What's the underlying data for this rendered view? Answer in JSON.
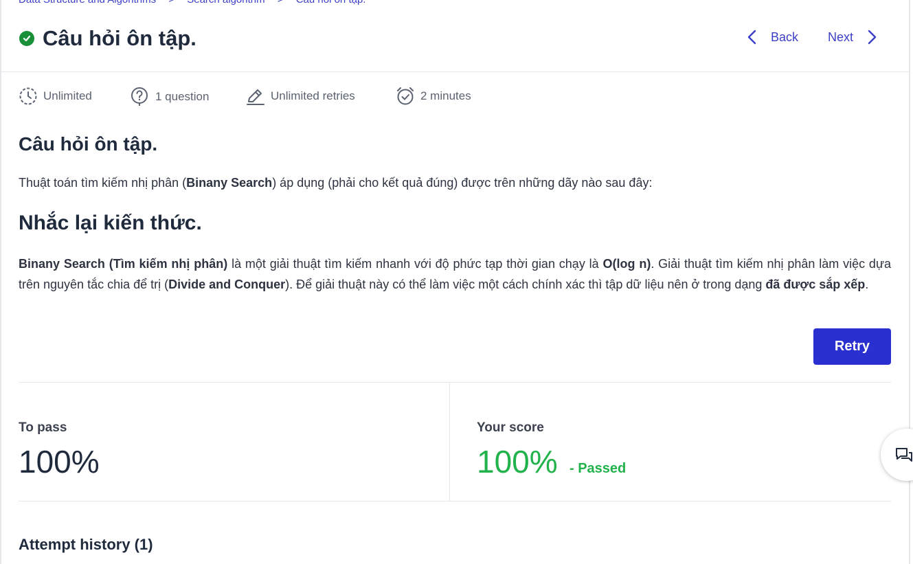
{
  "breadcrumb": [
    "Data Structure and Algorithms",
    ">",
    "Search algorithm",
    ">",
    "Câu hỏi ôn tập."
  ],
  "header": {
    "title": "Câu hỏi ôn tập.",
    "back_label": "Back",
    "next_label": "Next"
  },
  "meta": {
    "time": "Unlimited",
    "questions": "1 question",
    "retries": "Unlimited retries",
    "duration": "2 minutes"
  },
  "content": {
    "section_title": "Câu hỏi ôn tập.",
    "question_pre": "Thuật toán tìm kiếm nhị phân (",
    "question_bold": "Binany Search",
    "question_post": ") áp dụng (phải cho kết quả đúng) được trên những dãy nào sau đây:",
    "remind_title": "Nhắc lại kiến thức.",
    "p1_bold": "Binany Search (Tìm kiếm nhị phân)",
    "p1_a": " là một giải thuật tìm kiếm nhanh với độ phức tạp thời gian chạy là ",
    "p1_bold2": "O(log n)",
    "p1_b": ". Giải thuật tìm kiếm nhị phân làm việc dựa trên nguyên tắc chia để trị (",
    "p1_bold3": "Divide and Conquer",
    "p1_c": "). Để giải thuật này có thể làm việc một cách chính xác thì tập dữ liệu nên ở trong dạng ",
    "p1_bold4": "đã được sắp xếp",
    "p1_d": "."
  },
  "retry_label": "Retry",
  "score": {
    "to_pass_label": "To pass",
    "to_pass_value": "100%",
    "your_score_label": "Your score",
    "your_score_value": "100%",
    "status": "- Passed"
  },
  "history_title": "Attempt history (1)",
  "colors": {
    "accent": "#2a2fcf",
    "link": "#3b3fc7",
    "pass": "#22b24c",
    "check": "#1a8f3a"
  }
}
